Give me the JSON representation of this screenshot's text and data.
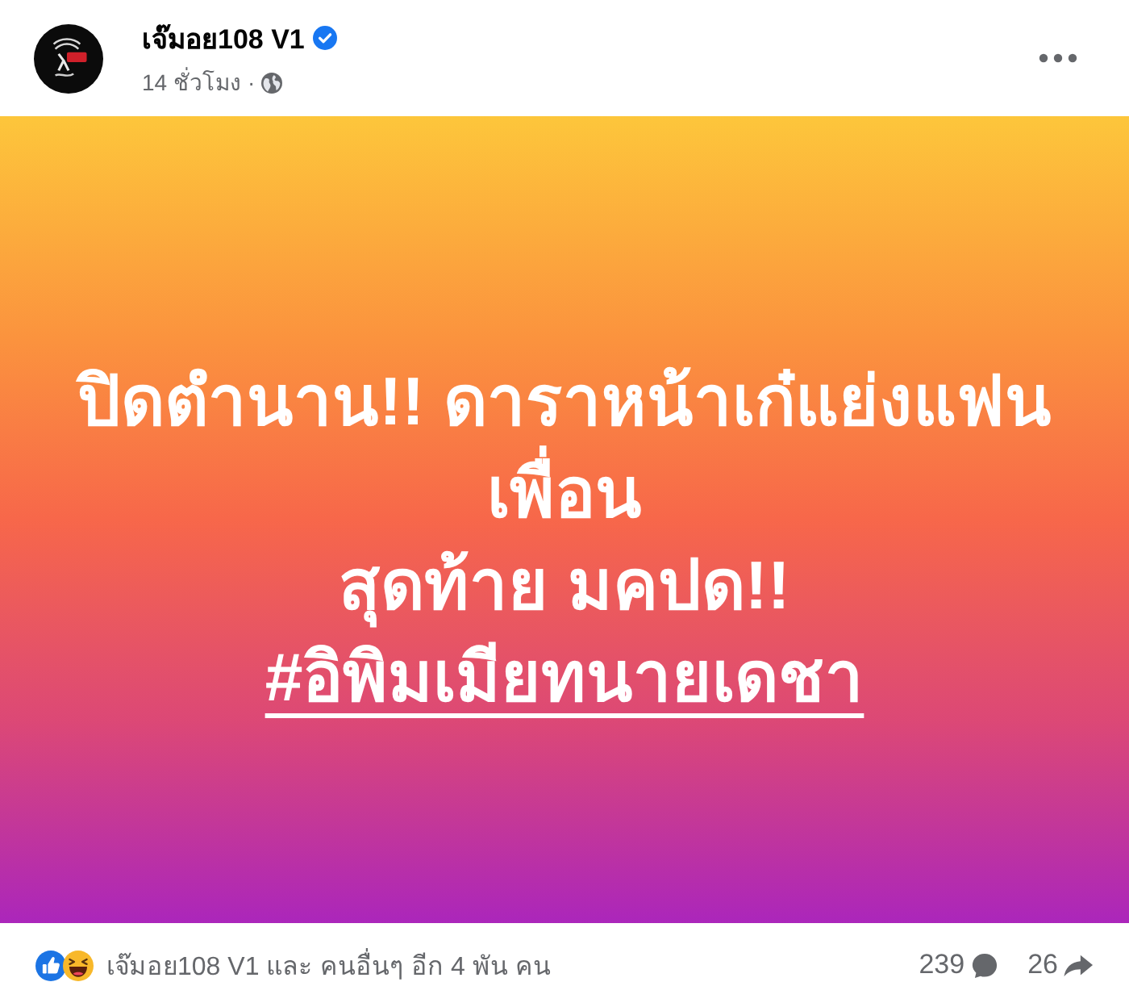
{
  "header": {
    "author": {
      "name": "เจ๊มอย108 V1",
      "verified": true
    },
    "time": "14 ชั่วโมง",
    "separator": "·"
  },
  "post": {
    "paragraphs": [
      "ปิดตำนาน!! ดาราหน้าเก๋แย่งแฟนเพื่อน",
      "สุดท้าย มคปด!!"
    ],
    "hashtag": "#อิพิมเมียทนายเดชา"
  },
  "footer": {
    "reactions": [
      {
        "kind": "like"
      },
      {
        "kind": "haha"
      }
    ],
    "summary": "เจ๊มอย108 V1 และ คนอื่นๆ อีก 4 พัน คน",
    "comments": "239",
    "shares": "26"
  }
}
